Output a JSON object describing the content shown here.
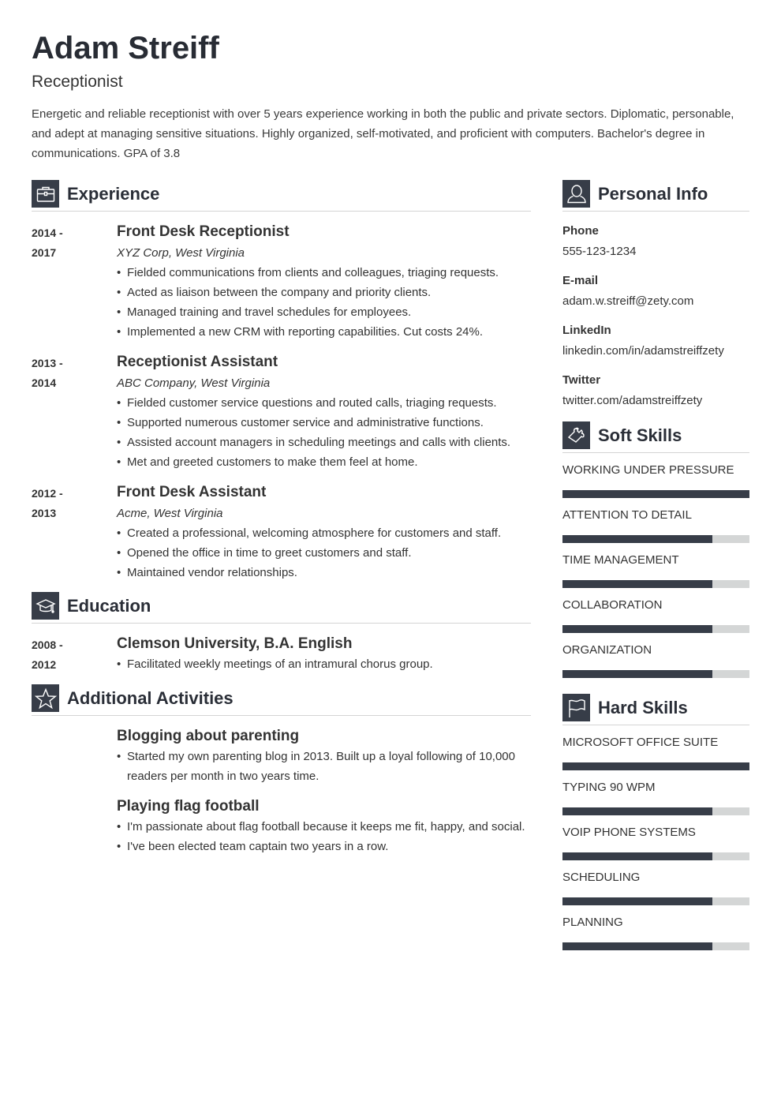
{
  "header": {
    "name": "Adam Streiff",
    "title": "Receptionist",
    "summary": "Energetic and reliable receptionist with over 5 years experience working in both the public and private sectors. Diplomatic, personable, and adept at managing sensitive situations. Highly organized, self-motivated, and proficient with computers. Bachelor's degree in communications. GPA of 3.8"
  },
  "colors": {
    "accent": "#373d48",
    "bar_empty": "#d4d6d6",
    "divider": "#d4d4d4"
  },
  "experience": {
    "heading": "Experience",
    "icon": "briefcase-icon",
    "entries": [
      {
        "date_start": "2014 -",
        "date_end": "2017",
        "title": "Front Desk Receptionist",
        "company": "XYZ Corp, West Virginia",
        "bullets": [
          "Fielded communications from clients and colleagues, triaging requests.",
          "Acted as liaison between the company and priority clients.",
          "Managed training and travel schedules for employees.",
          "Implemented a new CRM with reporting capabilities. Cut costs 24%."
        ]
      },
      {
        "date_start": "2013 -",
        "date_end": "2014",
        "title": "Receptionist Assistant",
        "company": "ABC Company, West Virginia",
        "bullets": [
          "Fielded customer service questions and routed calls, triaging requests.",
          "Supported numerous customer service and administrative functions.",
          "Assisted account managers in scheduling meetings and calls with clients.",
          "Met and greeted customers to make them feel at home."
        ]
      },
      {
        "date_start": "2012 -",
        "date_end": "2013",
        "title": "Front Desk Assistant",
        "company": "Acme, West Virginia",
        "bullets": [
          "Created a professional, welcoming atmosphere for customers and staff.",
          "Opened the office in time to greet customers and staff.",
          "Maintained vendor relationships."
        ]
      }
    ]
  },
  "education": {
    "heading": "Education",
    "icon": "graduation-cap-icon",
    "entries": [
      {
        "date_start": "2008 -",
        "date_end": "2012",
        "title": "Clemson University, B.A. English",
        "bullets": [
          "Facilitated weekly meetings of an intramural chorus group."
        ]
      }
    ]
  },
  "activities": {
    "heading": "Additional Activities",
    "icon": "star-icon",
    "entries": [
      {
        "title": "Blogging about parenting",
        "bullets": [
          "Started my own parenting blog in 2013. Built up a loyal following of 10,000 readers per month in two years time."
        ]
      },
      {
        "title": "Playing flag football",
        "bullets": [
          "I'm passionate about flag football because it keeps me fit, happy, and social.",
          "I've been elected team captain two years in a row."
        ]
      }
    ]
  },
  "personal_info": {
    "heading": "Personal Info",
    "icon": "user-icon",
    "items": [
      {
        "label": "Phone",
        "value": "555-123-1234"
      },
      {
        "label": "E-mail",
        "value": "adam.w.streiff@zety.com"
      },
      {
        "label": "LinkedIn",
        "value": "linkedin.com/in/adamstreiffzety"
      },
      {
        "label": "Twitter",
        "value": "twitter.com/adamstreiffzety"
      }
    ]
  },
  "soft_skills": {
    "heading": "Soft Skills",
    "icon": "puzzle-icon",
    "items": [
      {
        "name": "WORKING UNDER PRESSURE",
        "level": 1.0
      },
      {
        "name": "ATTENTION TO DETAIL",
        "level": 0.8
      },
      {
        "name": "TIME MANAGEMENT",
        "level": 0.8
      },
      {
        "name": "COLLABORATION",
        "level": 0.8
      },
      {
        "name": "ORGANIZATION",
        "level": 0.8
      }
    ]
  },
  "hard_skills": {
    "heading": "Hard Skills",
    "icon": "flag-icon",
    "items": [
      {
        "name": "MICROSOFT OFFICE SUITE",
        "level": 1.0
      },
      {
        "name": "TYPING 90 WPM",
        "level": 0.8
      },
      {
        "name": "VOIP PHONE SYSTEMS",
        "level": 0.8
      },
      {
        "name": "SCHEDULING",
        "level": 0.8
      },
      {
        "name": "PLANNING",
        "level": 0.8
      }
    ]
  }
}
